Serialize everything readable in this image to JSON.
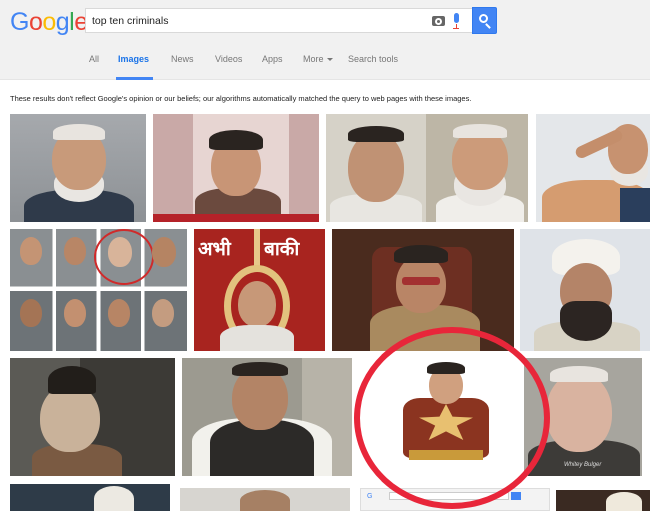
{
  "logo": {
    "letters": [
      "G",
      "o",
      "o",
      "g",
      "l",
      "e"
    ]
  },
  "search": {
    "query": "top ten criminals",
    "button_icon": "search-icon"
  },
  "tabs": [
    {
      "label": "All"
    },
    {
      "label": "Images"
    },
    {
      "label": "News"
    },
    {
      "label": "Videos"
    },
    {
      "label": "Apps"
    },
    {
      "label": "More"
    },
    {
      "label": "Search tools"
    }
  ],
  "notice": "These results don't reflect Google's opinion or our beliefs; our algorithms automatically matched the query to web pages with these images.",
  "image_captions": {
    "hindi_left": "अभी",
    "hindi_right": "बाकी",
    "watermark": "Whitey Bulger"
  },
  "colors": {
    "accent_blue": "#4285f4",
    "highlight_circle": "#e8263a",
    "header_bg": "#f1f1f1"
  }
}
